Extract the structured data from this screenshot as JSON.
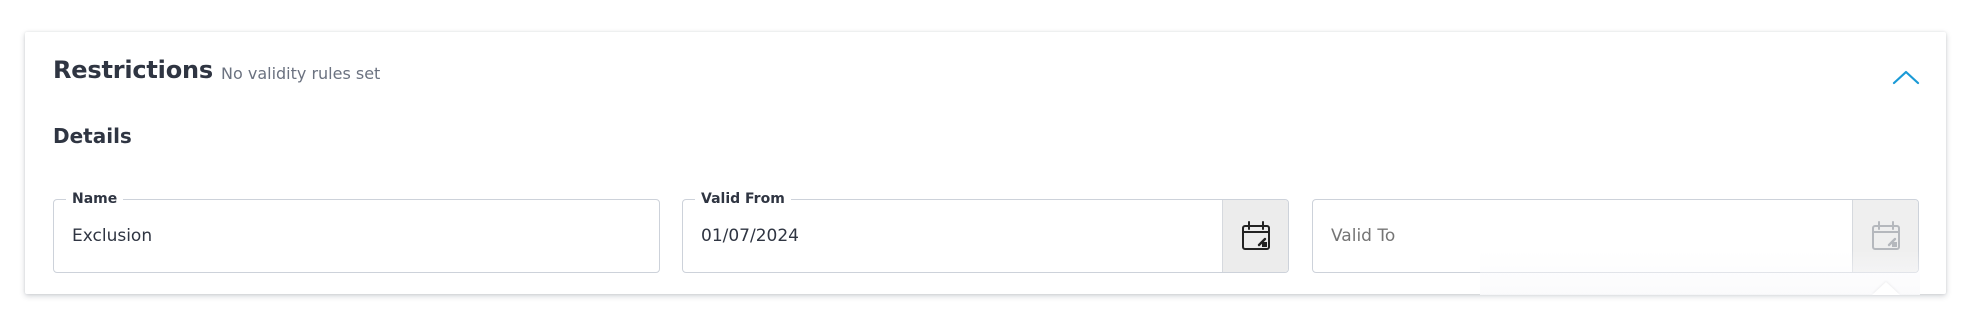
{
  "header": {
    "title": "Restrictions",
    "subtitle": "No validity rules set",
    "collapse_icon": "chevron-up-icon"
  },
  "details": {
    "title": "Details",
    "fields": [
      {
        "label": "Name",
        "value": "Exclusion",
        "placeholder": ""
      },
      {
        "label": "Valid From",
        "value": "01/07/2024",
        "placeholder": "",
        "icon": "calendar-icon"
      },
      {
        "label": "",
        "value": "",
        "placeholder": "Valid To",
        "icon": "calendar-icon",
        "disabled": true
      }
    ]
  },
  "colors": {
    "accent": "#1a9ad6",
    "text": "#2f3542",
    "muted": "#6b7280",
    "border": "#cdd2da",
    "icon_button_bg": "#ececec"
  }
}
